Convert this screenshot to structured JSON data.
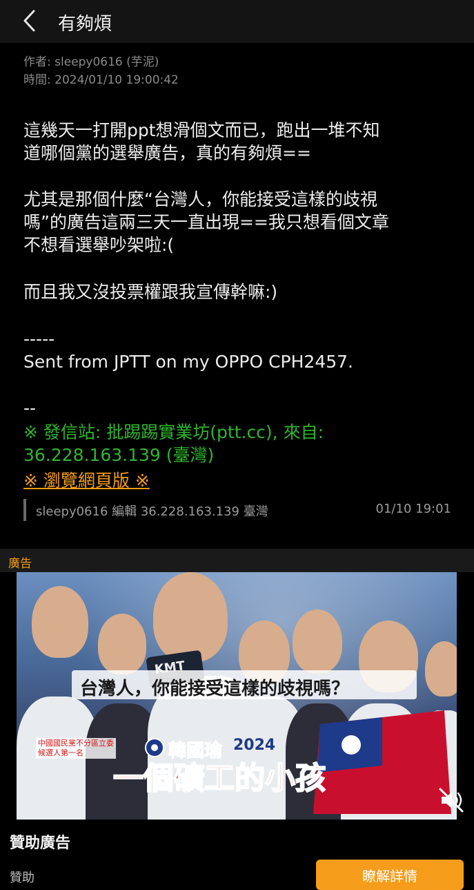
{
  "header": {
    "title": "有夠煩"
  },
  "meta": {
    "author": "作者: sleepy0616 (芋泥)",
    "time": "時間: 2024/01/10 19:00:42"
  },
  "body": {
    "p1_line1": "這幾天一打開ppt想滑個文而已，跑出一堆不知",
    "p1_line2": "道哪個黨的選舉廣告，真的有夠煩==",
    "p2_line1": "尤其是那個什麼“台灣人，你能接受這樣的歧視",
    "p2_line2": "嗎”的廣告這兩三天一直出現==我只想看個文章",
    "p2_line3": "不想看選舉吵架啦:(",
    "p3": "而且我又沒投票權跟我宣傳幹嘛:)",
    "sig_dashes": "-----",
    "sig_sent": "Sent from JPTT on my OPPO CPH2457.",
    "sep": "--",
    "site_line1": "※ 發信站: 批踢踢實業坊(ptt.cc), 來自:",
    "site_line2": "36.228.163.139 (臺灣)",
    "web_link": "※ 瀏覽網頁版 ※"
  },
  "edit": {
    "text": "sleepy0616 編輯 36.228.163.139 臺灣",
    "time": "01/10 19:01"
  },
  "ad": {
    "label": "廣告",
    "caption_question": "台灣人，你能接受這樣的歧視嗎？",
    "caption_title": "一個礦工的小孩",
    "candidate_name": "韓國瑜",
    "small_red_line1": "中國國民黨不分區立委",
    "small_red_line2": "候選人第一名",
    "mic_label": "KMT",
    "year_on_shirt": "2024",
    "sponsor_heading": "贊助廣告",
    "sponsor_small": "贊助",
    "cta_label": "瞭解詳情",
    "accent_color": "#f59c1a"
  }
}
